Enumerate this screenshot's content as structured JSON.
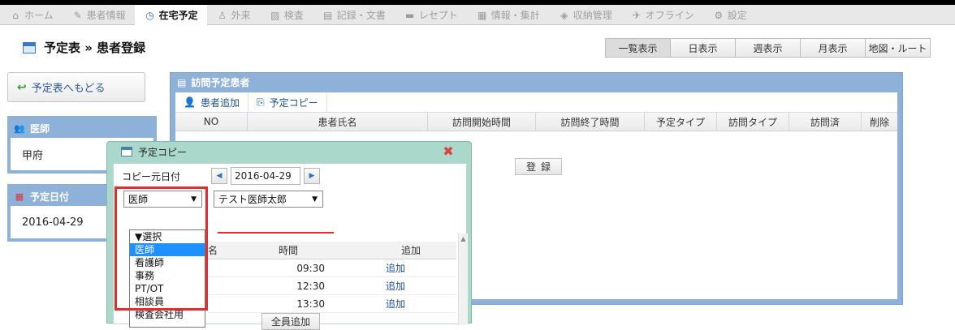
{
  "nav": {
    "items": [
      {
        "label": "ホーム",
        "icon": "home-icon",
        "glyph": "⌂",
        "active": false
      },
      {
        "label": "患者情報",
        "icon": "wrench-icon",
        "glyph": "✎",
        "active": false
      },
      {
        "label": "在宅予定",
        "icon": "clock-icon",
        "glyph": "◷",
        "active": true
      },
      {
        "label": "外来",
        "icon": "lock-icon",
        "glyph": "♙",
        "active": false
      },
      {
        "label": "検査",
        "icon": "chart-icon",
        "glyph": "▨",
        "active": false
      },
      {
        "label": "記録・文書",
        "icon": "document-icon",
        "glyph": "▤",
        "active": false
      },
      {
        "label": "レセプト",
        "icon": "receipt-icon",
        "glyph": "▬",
        "active": false
      },
      {
        "label": "情報・集計",
        "icon": "stats-icon",
        "glyph": "▦",
        "active": false
      },
      {
        "label": "収納管理",
        "icon": "money-icon",
        "glyph": "◈",
        "active": false
      },
      {
        "label": "オフライン",
        "icon": "offline-icon",
        "glyph": "✈",
        "active": false
      },
      {
        "label": "設定",
        "icon": "gear-icon",
        "glyph": "⚙",
        "active": false
      }
    ]
  },
  "page": {
    "title": "予定表 » 患者登録",
    "view_tabs": [
      "一覧表示",
      "日表示",
      "週表示",
      "月表示",
      "地図・ルート"
    ],
    "back_button": "予定表へもどる"
  },
  "sidebar": {
    "doctor": {
      "label": "医師",
      "value": "甲府"
    },
    "schedule_date": {
      "label": "予定日付",
      "value": "2016-04-29"
    }
  },
  "main": {
    "title": "訪問予定患者",
    "toolbar": {
      "add_patient": "患者追加",
      "copy_schedule": "予定コピー"
    },
    "columns": [
      "NO",
      "患者氏名",
      "訪問開始時間",
      "訪問終了時間",
      "予定タイプ",
      "訪問タイプ",
      "訪問済",
      "削除"
    ],
    "register_button": "登録"
  },
  "dialog": {
    "title": "予定コピー",
    "source_date_label": "コピー元日付",
    "source_date": "2016-04-29",
    "staff_type_selected": "医師",
    "staff_name_selected": "テスト医師太郎",
    "staff_type_options": [
      "▼選択",
      "医師",
      "看護師",
      "事務",
      "PT/OT",
      "相談員",
      "検査会社用"
    ],
    "list_head": {
      "partial_col": "名",
      "time": "時間",
      "add": "追加"
    },
    "rows": [
      {
        "time": "09:30",
        "action": "追加"
      },
      {
        "time": "12:30",
        "action": "追加"
      },
      {
        "time": "13:30",
        "action": "追加"
      }
    ],
    "add_all_button": "全員追加"
  },
  "colors": {
    "panel_blue": "#8eb1d9",
    "dialog_green": "#aad8ca",
    "highlight_red": "#e02d2d",
    "selected_blue": "#1e90ff"
  }
}
